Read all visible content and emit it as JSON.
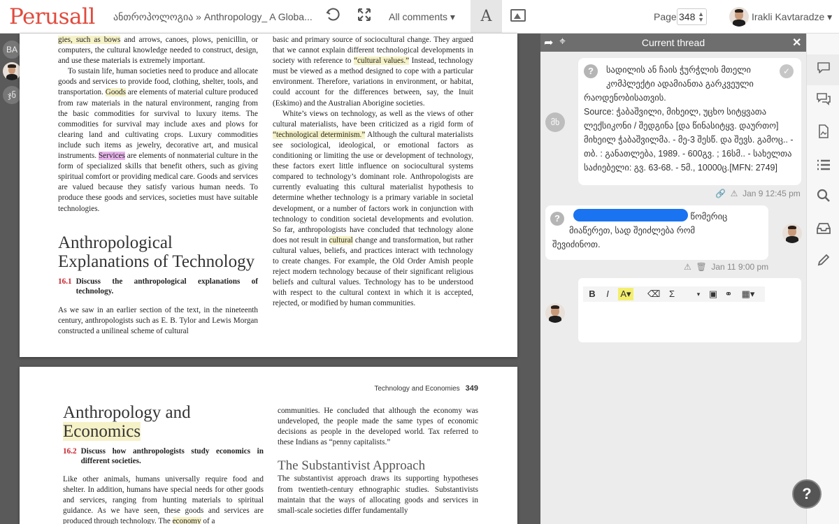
{
  "app": {
    "logo": "Perusall",
    "breadcrumb": "ანთროპოლოგია  »  Anthropology_ A Globa...",
    "all_comments": "All comments ▾",
    "page_label": "Page",
    "page_value": "348",
    "user_name": "Irakli Kavtaradze ▾",
    "icons": [
      "undo-icon",
      "fullscreen-icon",
      "text-view-icon",
      "image-view-icon"
    ]
  },
  "rail": {
    "items": [
      "BA",
      "ჯნ"
    ]
  },
  "page1": {
    "left_col_p1": "gies, such as bows and arrows, canoes, plows, penicillin, or computers, the cultural knowledge needed to construct, design, and use these materials is extremely important.",
    "left_col_p2_a": "To sustain life, human societies need to produce and allocate goods and services to provide food, clothing, shelter, tools, and transportation. ",
    "left_col_p2_goods": "Goods",
    "left_col_p2_b": " are elements of material culture produced from raw materials in the natural environment, ranging from the basic commodities for survival to luxury items. The commodities for survival may include axes and plows for clearing land and cultivating crops. Luxury commodities include such items as jewelry, decorative art, and musical instruments. ",
    "left_col_p2_services": "Services",
    "left_col_p2_c": " are elements of nonmaterial culture in the form of specialized skills that benefit others, such as giving spiritual comfort or providing medical care. Goods and services are valued because they satisfy various human needs. To produce these goods and services, societies must have suitable technologies.",
    "heading": "Anthropological Explanations of Technology",
    "lo_num": "16.1",
    "lo_text": "Discuss the anthropological explanations of technology.",
    "left_col_p3": "As we saw in an earlier section of the text, in the nineteenth century, anthropologists such as E. B. Tylor and Lewis Morgan constructed a unilineal scheme of cultural",
    "right_col_p1_a": "basic and primary source of sociocultural change. They argued that we cannot explain different technological developments in society with reference to ",
    "right_col_p1_hl": "“cultural values.”",
    "right_col_p1_b": " Instead, technology must be viewed as a method designed to cope with a particular environment. Therefore, variations in environment, or habitat, could account for the differences between, say, the Inuit (Eskimo) and the Australian Aborigine societies.",
    "right_col_p2_a": "White’s views on technology, as well as the views of other cultural materialists, have been criticized as a rigid form of ",
    "right_col_p2_hl": "“technological determinism.”",
    "right_col_p2_b": " Although the cultural materialists see sociological, ideological, or emotional factors as conditioning or limiting the use or development of technology, these factors exert little influence on sociocultural systems compared to technology’s dominant role. Anthropologists are currently evaluating this cultural materialist hypothesis to determine whether technology is a primary variable in societal development, or a number of factors work in conjunction with technology to condition societal developments and evolution. So far, anthropologists have concluded that technology alone does not result in ",
    "right_col_p2_hl2": "cultural",
    "right_col_p2_c": " change and transformation, but rather cultural values, beliefs, and practices interact with technology to create changes. For example, the Old Order Amish people reject modern technology because of their significant religious beliefs and cultural values. Technology has to be understood with respect to the cultural context in which it is accepted, rejected, or modified by human communities."
  },
  "page2": {
    "running_head": "Technology and Economies",
    "page_number": "349",
    "heading_1": "Anthropology and",
    "heading_2": "Economics",
    "lo_num": "16.2",
    "lo_text": "Discuss how anthropologists study economics in different societies.",
    "left_col_a": "Like other animals, humans universally require food and shelter. In addition, humans have special needs for other goods and services, ranging from hunting materials to spiritual guidance. As we have seen, these goods and services are produced through technology. The ",
    "left_col_hl": "economy",
    "left_col_b": " of a",
    "right_col_p1": "communities. He concluded that although the economy was undeveloped, the people made the same types of economic decisions as people in the developed world. Tax referred to these Indians as “penny capitalists.”",
    "subheading": "The Substantivist Approach",
    "right_col_p2": "The substantivist approach draws its supporting hypotheses from twentieth-century ethnographic studies. Substantivists maintain that the ways of allocating goods and services in small-scale societies differ fundamentally"
  },
  "panel": {
    "title": "Current thread",
    "comment1": {
      "author_initials": "მხ",
      "line1": "სადილის ან ჩაის ჭურჭლის მთელი",
      "line2": "კომპლექტი ადამიანთა გარკვეული",
      "line3": "რაოდენობისათვის.",
      "source": "Source: ჭაბაშვილი, მიხეილ, უცხო სიტყვათა ლექსიკონი / შედგინა [და წინასიტყვ. დაურთო] მიხეილ ჭაბაშვილმა. - მე-3 შესწ. და შევს. გამოც.. - თბ. : განათლება, 1989. - 600გვ. ; 16სმ.. - სახელთა საძიებელი: გვ. 63-68. - 5მ., 10000ც.[MFN: 2749]",
      "date": "Jan 9 12:45 pm"
    },
    "comment2": {
      "text_after": "წომერიც",
      "line2": "მიაწერეთ, სად შეიძლება რომ",
      "line3": "შევიძინოთ.",
      "date": "Jan 11 9:00 pm"
    },
    "editor": {
      "buttons": [
        "B",
        "I",
        "A",
        "⌫",
        "Σ",
        "▾",
        "image",
        "link",
        "table"
      ]
    }
  },
  "sidebar": {
    "items": [
      "comments-icon",
      "conversations-icon",
      "document-icon",
      "list-icon",
      "search-icon",
      "inbox-icon",
      "pencil-icon"
    ]
  },
  "help_label": "?"
}
